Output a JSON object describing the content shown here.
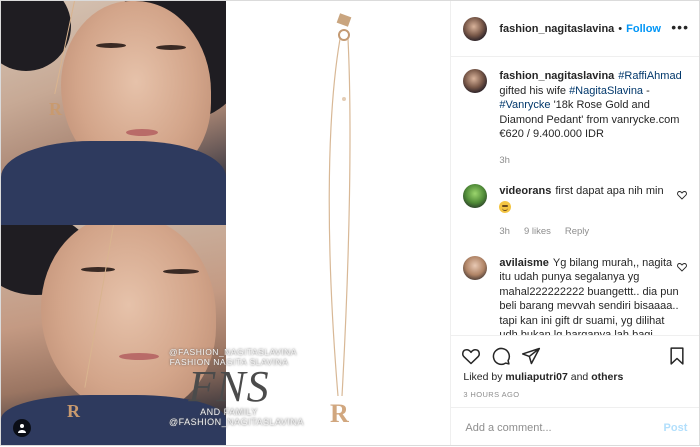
{
  "header": {
    "username": "fashion_nagitaslavina",
    "separator": "•",
    "follow_label": "Follow",
    "more_label": "•••"
  },
  "caption": {
    "username": "fashion_nagitaslavina",
    "text_parts": [
      "#RaffiAhmad",
      " gifted his wife ",
      "#NagitaSlavina",
      " - ",
      "#Vanrycke",
      " '18k Rose Gold and Diamond Pedant' from vanrycke.com €620 / 9.400.000 IDR"
    ],
    "time": "3h"
  },
  "comments": [
    {
      "username": "videorans",
      "text": "first dapat apa nih min",
      "emoji": "grimacing-face-emoji",
      "time": "3h",
      "likes": "9 likes",
      "reply": "Reply"
    },
    {
      "username": "avilaisme",
      "text": "Yg bilang murah,, nagita itu udah punya segalanya yg mahal222222222 buangettt.. dia pun beli barang mevvah sendiri bisaaaa.. tapi kan ini gift dr suami, yg dilihat udh bukan lg harganya lah bagi seorang gigi,"
    }
  ],
  "liked_by": {
    "prefix": "Liked by ",
    "user": "muliaputri07",
    "connector": " and ",
    "others": "others"
  },
  "timestamp": "3 HOURS AGO",
  "add_comment": {
    "placeholder": "Add a comment...",
    "post_label": "Post"
  },
  "watermark": {
    "handle_top": "@FASHION_NAGITASLAVINA",
    "name_line": "FASHION NAGITA SLAVINA",
    "logo_text": "FNS",
    "family": "AND FAMILY",
    "handle_bottom": "@FASHION_NAGITASLAVINA"
  },
  "pendant_letter": "R",
  "colors": {
    "link": "#00376b",
    "follow": "#0095f6",
    "muted": "#8e8e8e",
    "post_disabled": "#b2dffc"
  }
}
